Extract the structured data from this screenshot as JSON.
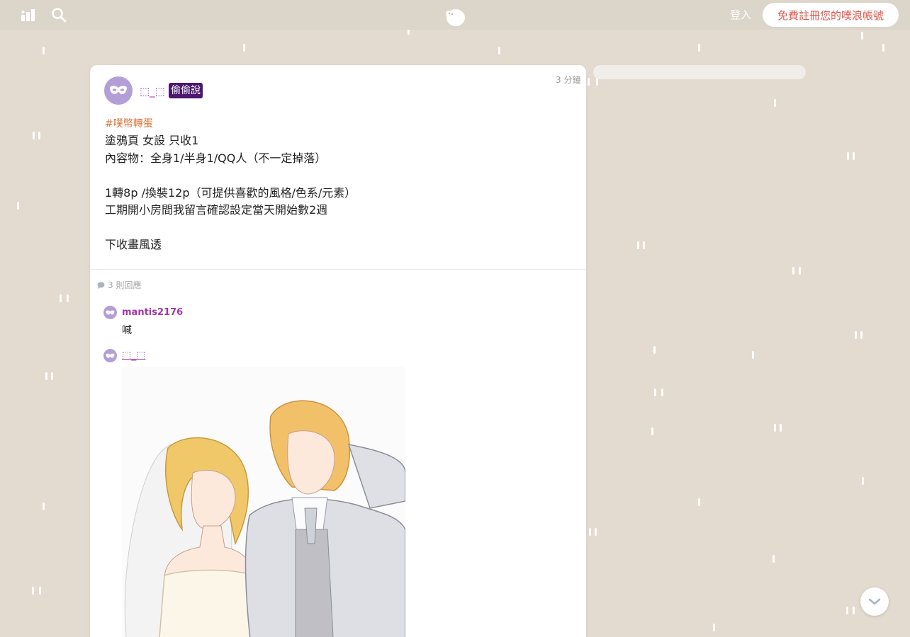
{
  "header": {
    "login_label": "登入",
    "signup_label": "免費註冊您的噗浪帳號",
    "icons": [
      "stats-icon",
      "search-icon",
      "plurk-logo"
    ]
  },
  "plurk": {
    "author": "⬚_⬚",
    "qualifier": "偷偷說",
    "time": "3 分鐘",
    "hashtag": "#噗幣轉蛋",
    "content": "塗鴉頁 女設 只收1\n內容物：全身1/半身1/QQ人（不一定掉落）\n\n1轉8p /換裝12p（可提供喜歡的風格/色系/元素）\n工期開小房間我留言確認設定當天開始數2週\n\n下收畫風透",
    "reply_count": "3 則回應"
  },
  "replies": [
    {
      "name": "mantis2176",
      "text": "喊"
    },
    {
      "name": "⬚_⬚",
      "has_image": true
    }
  ],
  "colors": {
    "background": "#e3dbcf",
    "topbar": "#dcd5ca",
    "accent_name": "#a237a7",
    "qualifier_bg": "#4b1770",
    "signup_text": "#e0584f",
    "hashtag": "#d6763b",
    "avatar": "#b49ed6"
  }
}
